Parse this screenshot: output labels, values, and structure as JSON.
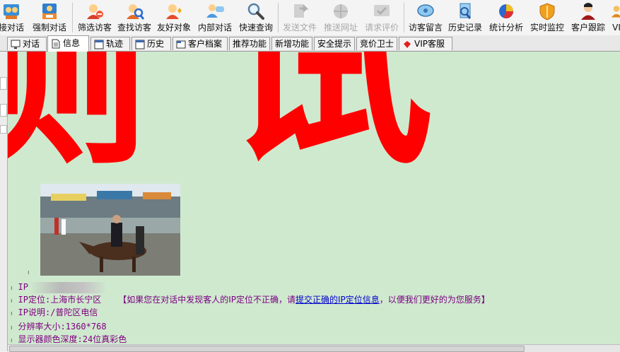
{
  "toolbar": {
    "items": [
      {
        "label": "接对话",
        "icon": "accept-chat-icon",
        "disabled": false
      },
      {
        "label": "强制对话",
        "icon": "force-chat-icon",
        "disabled": false
      },
      {
        "label": "筛选访客",
        "icon": "filter-visitor-icon",
        "disabled": false
      },
      {
        "label": "查找访客",
        "icon": "find-visitor-icon",
        "disabled": false
      },
      {
        "label": "友好对象",
        "icon": "friend-icon",
        "disabled": false
      },
      {
        "label": "内部对话",
        "icon": "internal-chat-icon",
        "disabled": false
      },
      {
        "label": "快速查询",
        "icon": "magnifier-icon",
        "disabled": false
      },
      {
        "label": "发送文件",
        "icon": "send-file-icon",
        "disabled": true
      },
      {
        "label": "推送网址",
        "icon": "push-url-icon",
        "disabled": true
      },
      {
        "label": "请求评价",
        "icon": "request-rating-icon",
        "disabled": true
      },
      {
        "label": "访客留言",
        "icon": "visitor-message-icon",
        "disabled": false
      },
      {
        "label": "历史记录",
        "icon": "history-record-icon",
        "disabled": false
      },
      {
        "label": "统计分析",
        "icon": "pie-chart-icon",
        "disabled": false
      },
      {
        "label": "实时监控",
        "icon": "shield-icon",
        "disabled": false
      },
      {
        "label": "客户跟踪",
        "icon": "user-track-icon",
        "disabled": false
      },
      {
        "label": "VI",
        "icon": "vip-icon",
        "disabled": false
      }
    ]
  },
  "tabs": [
    {
      "label": "对话",
      "icon": "monitor-icon"
    },
    {
      "label": "信息",
      "icon": "document-icon",
      "active": true
    },
    {
      "label": "轨迹",
      "icon": "window-icon"
    },
    {
      "label": "历史",
      "icon": "window-icon"
    },
    {
      "label": "客户档案",
      "icon": "folder-icon"
    },
    {
      "label": "推荐功能"
    },
    {
      "label": "新增功能"
    },
    {
      "label": "安全提示"
    },
    {
      "label": "竞价卫士"
    },
    {
      "label": "VIP客服",
      "icon": "red-diamond-icon"
    }
  ],
  "content": {
    "big_red_text": "测 试",
    "photo_alt": "animated-horse-rider-image",
    "info": {
      "ip_label": "IP",
      "ip_location": "IP定位:上海市长宁区",
      "notice_prefix": "【如果您在对话中发现客人的IP定位不正确，请",
      "notice_link": "提交正确的IP定位信息",
      "notice_suffix": "，以便我们更好的为您服务】",
      "ip_desc": "IP说明:/普陀区电信",
      "resolution": "分辨率大小:1360*768",
      "color_depth": "显示器颜色深度:24位真彩色"
    }
  },
  "colors": {
    "content_bg": "#cfe9cf",
    "big_text": "#ff0000",
    "info_text": "#800080",
    "link": "#0000cc"
  }
}
